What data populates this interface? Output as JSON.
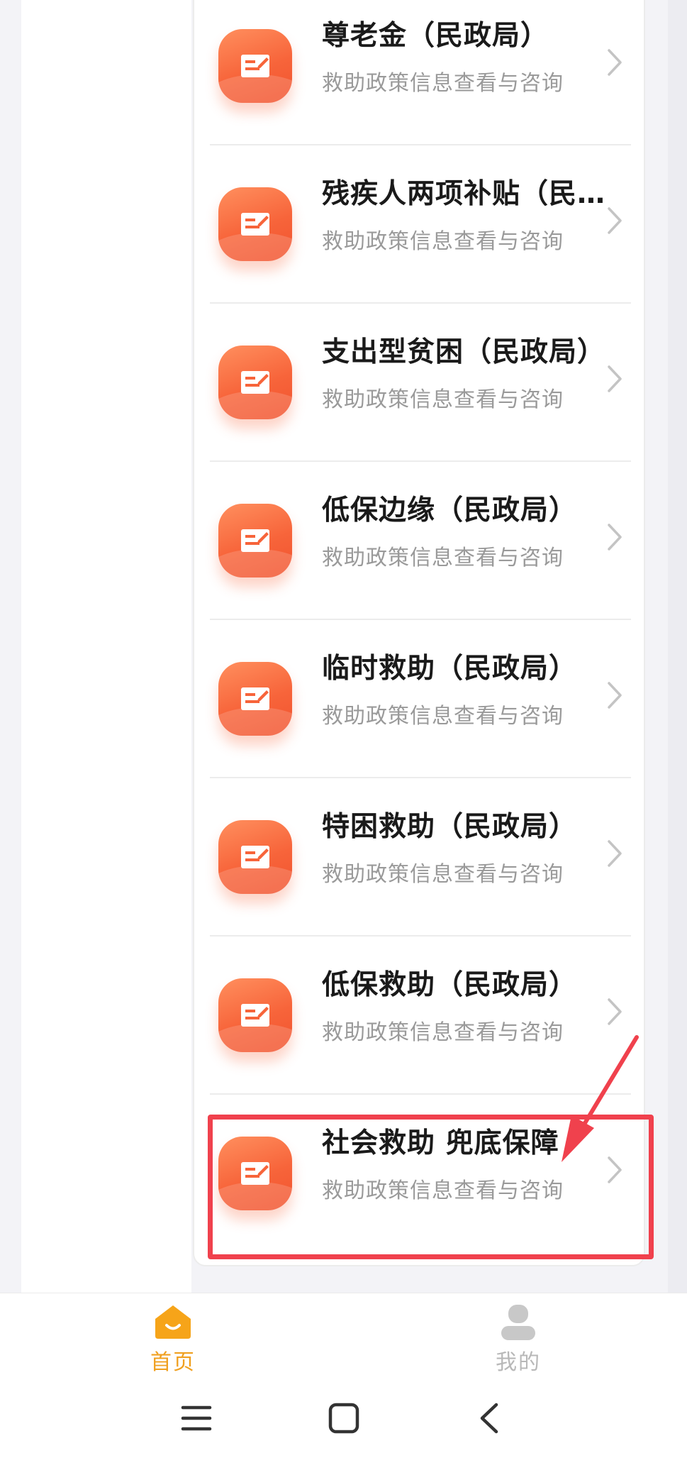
{
  "list": {
    "items": [
      {
        "title": "尊老金（民政局）",
        "subtitle": "救助政策信息查看与咨询"
      },
      {
        "title": "残疾人两项补贴（民政局）",
        "subtitle": "救助政策信息查看与咨询"
      },
      {
        "title": "支出型贫困（民政局）",
        "subtitle": "救助政策信息查看与咨询"
      },
      {
        "title": "低保边缘（民政局）",
        "subtitle": "救助政策信息查看与咨询"
      },
      {
        "title": "临时救助（民政局）",
        "subtitle": "救助政策信息查看与咨询"
      },
      {
        "title": "特困救助（民政局）",
        "subtitle": "救助政策信息查看与咨询"
      },
      {
        "title": "低保救助（民政局）",
        "subtitle": "救助政策信息查看与咨询"
      },
      {
        "title": "社会救助 兜底保障",
        "subtitle": "救助政策信息查看与咨询"
      }
    ],
    "icon": "document-edit-icon",
    "accent_color": "#f7643a"
  },
  "annotation": {
    "highlight_color": "#f0414d",
    "highlighted_item": 7
  },
  "tabbar": {
    "home_label": "首页",
    "mine_label": "我的",
    "active_color": "#f0a020",
    "inactive_color": "#b8b8b8"
  },
  "system_nav": {
    "menu_icon": "menu-icon",
    "home_icon": "square-home-icon",
    "back_icon": "back-chevron-icon"
  }
}
